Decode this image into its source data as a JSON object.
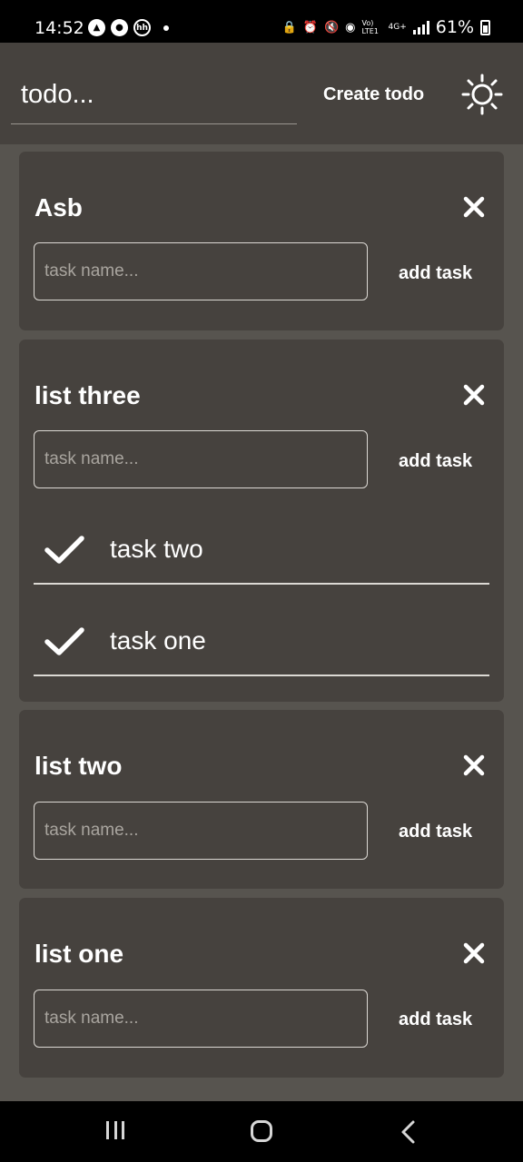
{
  "status_bar": {
    "time": "14:52",
    "network": "4G+",
    "volte": "Vo) LTE1",
    "battery": "61%",
    "left_icons": [
      "android-auto-icon",
      "account-icon",
      "hh-icon"
    ]
  },
  "header": {
    "todo_input_value": "todo...",
    "create_label": "Create todo",
    "theme_icon": "sun-icon"
  },
  "task_placeholder": "task name...",
  "add_task_label": "add task",
  "lists": [
    {
      "title": "Asb",
      "tasks": []
    },
    {
      "title": "list three",
      "tasks": [
        {
          "name": "task two",
          "done": true
        },
        {
          "name": "task one",
          "done": true
        }
      ]
    },
    {
      "title": "list two",
      "tasks": []
    },
    {
      "title": "list one",
      "tasks": []
    }
  ],
  "colors": {
    "background": "#57544f",
    "card": "#46423e",
    "text": "#ffffff",
    "placeholder": "#a9a59f"
  }
}
